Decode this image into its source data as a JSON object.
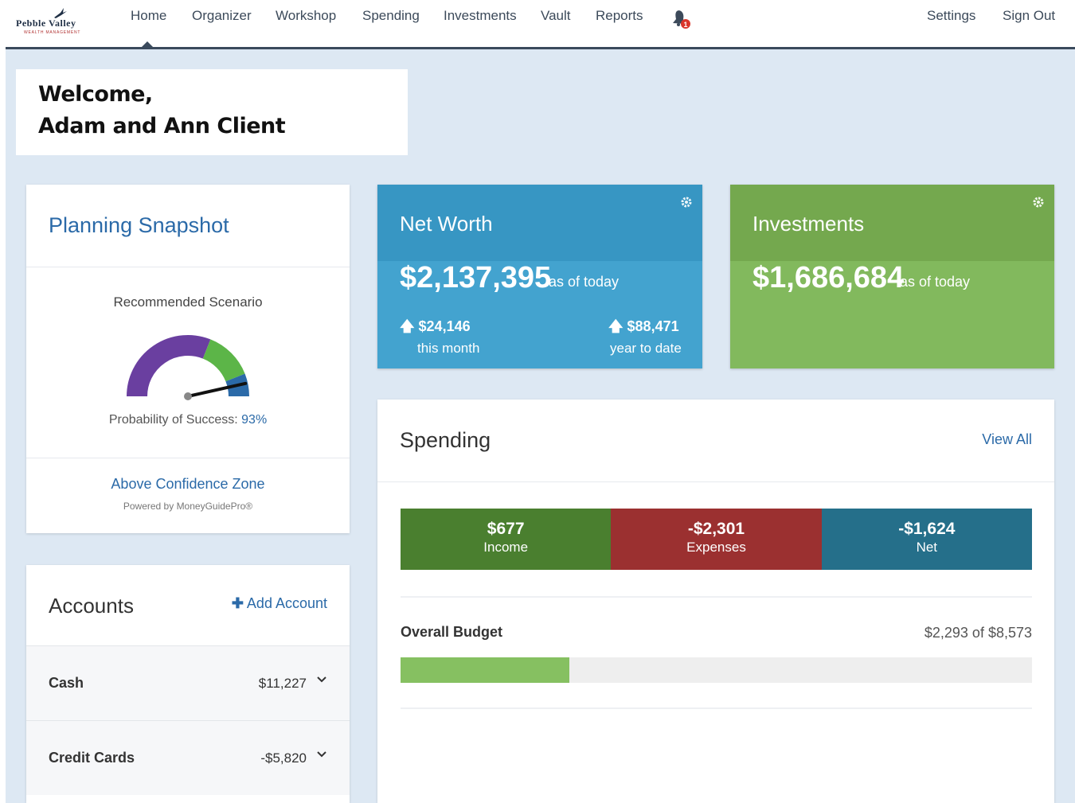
{
  "brand": {
    "name": "Pebble Valley",
    "sub": "WEALTH MANAGEMENT"
  },
  "nav": {
    "items": [
      "Home",
      "Organizer",
      "Workshop",
      "Spending",
      "Investments",
      "Vault",
      "Reports"
    ],
    "active": "Home",
    "settings": "Settings",
    "sign_out": "Sign Out",
    "notification_count": "1"
  },
  "welcome": {
    "line1": "Welcome,",
    "line2": "Adam and Ann Client"
  },
  "snapshot": {
    "title": "Planning Snapshot",
    "scenario": "Recommended Scenario",
    "probability_label": "Probability of Success:",
    "probability_value": "93%",
    "zone": "Above Confidence Zone",
    "powered": "Powered by MoneyGuidePro®",
    "gauge_colors": {
      "low": "#6a3fa0",
      "mid": "#5cb548",
      "high": "#2b6aa8"
    },
    "gauge_probability": 93
  },
  "net_worth": {
    "title": "Net Worth",
    "amount": "$2,137,395",
    "as_of": "as of today",
    "month_change": "$24,146",
    "month_label": "this month",
    "ytd_change": "$88,471",
    "ytd_label": "year to date"
  },
  "investments": {
    "title": "Investments",
    "amount": "$1,686,684",
    "as_of": "as of today"
  },
  "spending": {
    "title": "Spending",
    "view_all": "View All",
    "segments": [
      {
        "value": "$677",
        "label": "Income",
        "color": "#4a7f2f"
      },
      {
        "value": "-$2,301",
        "label": "Expenses",
        "color": "#9b3030"
      },
      {
        "value": "-$1,624",
        "label": "Net",
        "color": "#256f8a"
      }
    ],
    "budget_label": "Overall Budget",
    "budget_value": "$2,293 of $8,573",
    "budget_fraction": 0.267
  },
  "accounts": {
    "title": "Accounts",
    "add": "Add Account",
    "rows": [
      {
        "label": "Cash",
        "value": "$11,227"
      },
      {
        "label": "Credit Cards",
        "value": "-$5,820"
      }
    ]
  }
}
